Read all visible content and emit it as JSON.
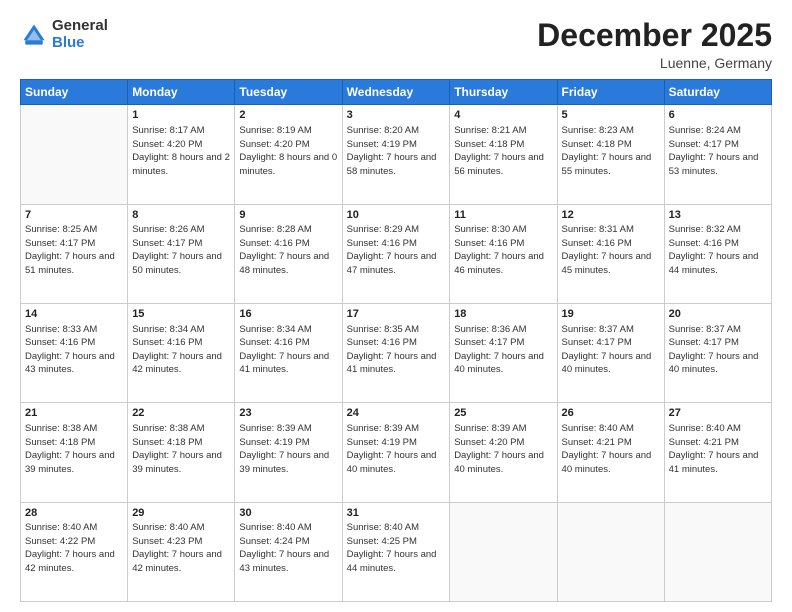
{
  "header": {
    "logo": {
      "general": "General",
      "blue": "Blue"
    },
    "title": "December 2025",
    "location": "Luenne, Germany"
  },
  "days_of_week": [
    "Sunday",
    "Monday",
    "Tuesday",
    "Wednesday",
    "Thursday",
    "Friday",
    "Saturday"
  ],
  "weeks": [
    [
      {
        "num": "",
        "sunrise": "",
        "sunset": "",
        "daylight": ""
      },
      {
        "num": "1",
        "sunrise": "Sunrise: 8:17 AM",
        "sunset": "Sunset: 4:20 PM",
        "daylight": "Daylight: 8 hours and 2 minutes."
      },
      {
        "num": "2",
        "sunrise": "Sunrise: 8:19 AM",
        "sunset": "Sunset: 4:20 PM",
        "daylight": "Daylight: 8 hours and 0 minutes."
      },
      {
        "num": "3",
        "sunrise": "Sunrise: 8:20 AM",
        "sunset": "Sunset: 4:19 PM",
        "daylight": "Daylight: 7 hours and 58 minutes."
      },
      {
        "num": "4",
        "sunrise": "Sunrise: 8:21 AM",
        "sunset": "Sunset: 4:18 PM",
        "daylight": "Daylight: 7 hours and 56 minutes."
      },
      {
        "num": "5",
        "sunrise": "Sunrise: 8:23 AM",
        "sunset": "Sunset: 4:18 PM",
        "daylight": "Daylight: 7 hours and 55 minutes."
      },
      {
        "num": "6",
        "sunrise": "Sunrise: 8:24 AM",
        "sunset": "Sunset: 4:17 PM",
        "daylight": "Daylight: 7 hours and 53 minutes."
      }
    ],
    [
      {
        "num": "7",
        "sunrise": "Sunrise: 8:25 AM",
        "sunset": "Sunset: 4:17 PM",
        "daylight": "Daylight: 7 hours and 51 minutes."
      },
      {
        "num": "8",
        "sunrise": "Sunrise: 8:26 AM",
        "sunset": "Sunset: 4:17 PM",
        "daylight": "Daylight: 7 hours and 50 minutes."
      },
      {
        "num": "9",
        "sunrise": "Sunrise: 8:28 AM",
        "sunset": "Sunset: 4:16 PM",
        "daylight": "Daylight: 7 hours and 48 minutes."
      },
      {
        "num": "10",
        "sunrise": "Sunrise: 8:29 AM",
        "sunset": "Sunset: 4:16 PM",
        "daylight": "Daylight: 7 hours and 47 minutes."
      },
      {
        "num": "11",
        "sunrise": "Sunrise: 8:30 AM",
        "sunset": "Sunset: 4:16 PM",
        "daylight": "Daylight: 7 hours and 46 minutes."
      },
      {
        "num": "12",
        "sunrise": "Sunrise: 8:31 AM",
        "sunset": "Sunset: 4:16 PM",
        "daylight": "Daylight: 7 hours and 45 minutes."
      },
      {
        "num": "13",
        "sunrise": "Sunrise: 8:32 AM",
        "sunset": "Sunset: 4:16 PM",
        "daylight": "Daylight: 7 hours and 44 minutes."
      }
    ],
    [
      {
        "num": "14",
        "sunrise": "Sunrise: 8:33 AM",
        "sunset": "Sunset: 4:16 PM",
        "daylight": "Daylight: 7 hours and 43 minutes."
      },
      {
        "num": "15",
        "sunrise": "Sunrise: 8:34 AM",
        "sunset": "Sunset: 4:16 PM",
        "daylight": "Daylight: 7 hours and 42 minutes."
      },
      {
        "num": "16",
        "sunrise": "Sunrise: 8:34 AM",
        "sunset": "Sunset: 4:16 PM",
        "daylight": "Daylight: 7 hours and 41 minutes."
      },
      {
        "num": "17",
        "sunrise": "Sunrise: 8:35 AM",
        "sunset": "Sunset: 4:16 PM",
        "daylight": "Daylight: 7 hours and 41 minutes."
      },
      {
        "num": "18",
        "sunrise": "Sunrise: 8:36 AM",
        "sunset": "Sunset: 4:17 PM",
        "daylight": "Daylight: 7 hours and 40 minutes."
      },
      {
        "num": "19",
        "sunrise": "Sunrise: 8:37 AM",
        "sunset": "Sunset: 4:17 PM",
        "daylight": "Daylight: 7 hours and 40 minutes."
      },
      {
        "num": "20",
        "sunrise": "Sunrise: 8:37 AM",
        "sunset": "Sunset: 4:17 PM",
        "daylight": "Daylight: 7 hours and 40 minutes."
      }
    ],
    [
      {
        "num": "21",
        "sunrise": "Sunrise: 8:38 AM",
        "sunset": "Sunset: 4:18 PM",
        "daylight": "Daylight: 7 hours and 39 minutes."
      },
      {
        "num": "22",
        "sunrise": "Sunrise: 8:38 AM",
        "sunset": "Sunset: 4:18 PM",
        "daylight": "Daylight: 7 hours and 39 minutes."
      },
      {
        "num": "23",
        "sunrise": "Sunrise: 8:39 AM",
        "sunset": "Sunset: 4:19 PM",
        "daylight": "Daylight: 7 hours and 39 minutes."
      },
      {
        "num": "24",
        "sunrise": "Sunrise: 8:39 AM",
        "sunset": "Sunset: 4:19 PM",
        "daylight": "Daylight: 7 hours and 40 minutes."
      },
      {
        "num": "25",
        "sunrise": "Sunrise: 8:39 AM",
        "sunset": "Sunset: 4:20 PM",
        "daylight": "Daylight: 7 hours and 40 minutes."
      },
      {
        "num": "26",
        "sunrise": "Sunrise: 8:40 AM",
        "sunset": "Sunset: 4:21 PM",
        "daylight": "Daylight: 7 hours and 40 minutes."
      },
      {
        "num": "27",
        "sunrise": "Sunrise: 8:40 AM",
        "sunset": "Sunset: 4:21 PM",
        "daylight": "Daylight: 7 hours and 41 minutes."
      }
    ],
    [
      {
        "num": "28",
        "sunrise": "Sunrise: 8:40 AM",
        "sunset": "Sunset: 4:22 PM",
        "daylight": "Daylight: 7 hours and 42 minutes."
      },
      {
        "num": "29",
        "sunrise": "Sunrise: 8:40 AM",
        "sunset": "Sunset: 4:23 PM",
        "daylight": "Daylight: 7 hours and 42 minutes."
      },
      {
        "num": "30",
        "sunrise": "Sunrise: 8:40 AM",
        "sunset": "Sunset: 4:24 PM",
        "daylight": "Daylight: 7 hours and 43 minutes."
      },
      {
        "num": "31",
        "sunrise": "Sunrise: 8:40 AM",
        "sunset": "Sunset: 4:25 PM",
        "daylight": "Daylight: 7 hours and 44 minutes."
      },
      {
        "num": "",
        "sunrise": "",
        "sunset": "",
        "daylight": ""
      },
      {
        "num": "",
        "sunrise": "",
        "sunset": "",
        "daylight": ""
      },
      {
        "num": "",
        "sunrise": "",
        "sunset": "",
        "daylight": ""
      }
    ]
  ]
}
